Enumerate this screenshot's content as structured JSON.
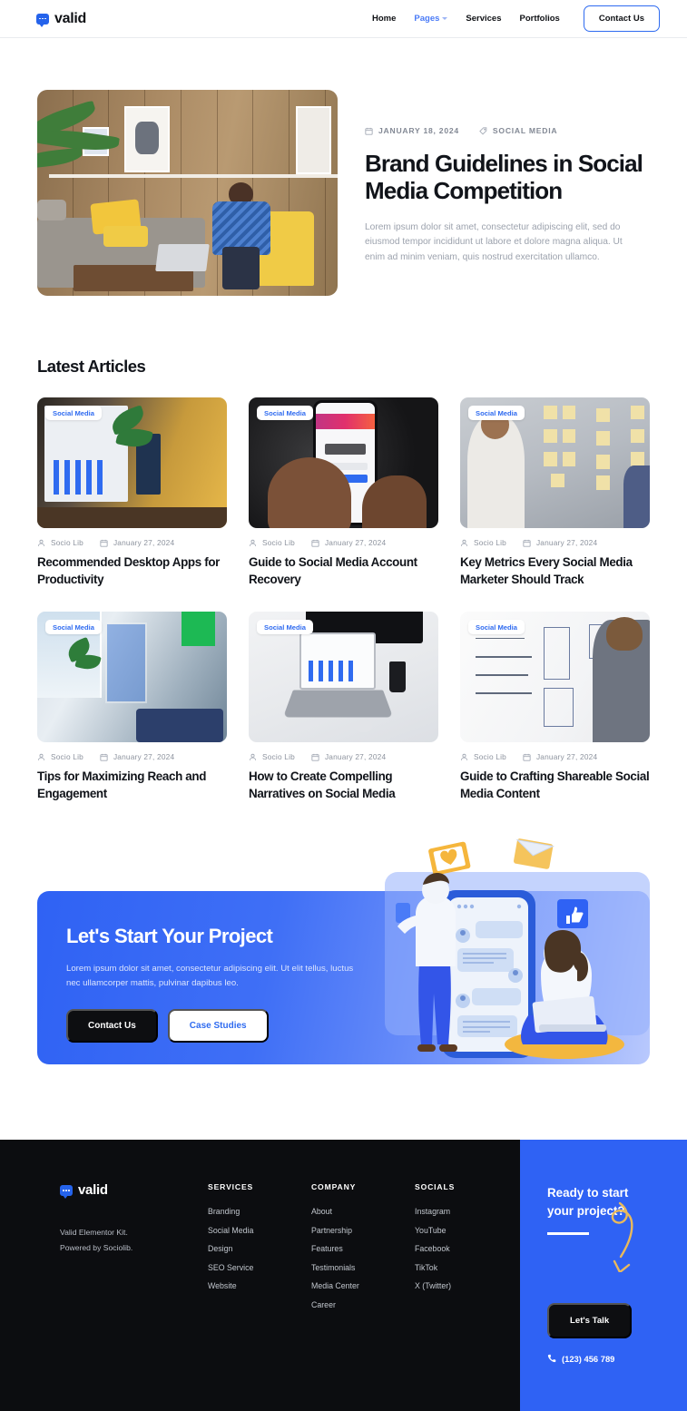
{
  "colors": {
    "brand_blue": "#2f62f4",
    "nav_active": "#4a7bf7",
    "dark": "#0c0d10",
    "badge_text": "#2f6bf0",
    "accent_yellow": "#e8b94a"
  },
  "header": {
    "logo": {
      "text": "valid",
      "icon": "chat-bubble-icon"
    },
    "nav": [
      {
        "label": "Home",
        "active": false,
        "has_caret": false
      },
      {
        "label": "Pages",
        "active": true,
        "has_caret": true
      },
      {
        "label": "Services",
        "active": false,
        "has_caret": false
      },
      {
        "label": "Portfolios",
        "active": false,
        "has_caret": false
      }
    ],
    "cta_label": "Contact Us"
  },
  "hero": {
    "date": "JANUARY 18, 2024",
    "date_icon": "calendar-icon",
    "category": "SOCIAL MEDIA",
    "category_icon": "tag-icon",
    "title": "Brand Guidelines in Social Media Competition",
    "description": "Lorem ipsum dolor sit amet, consectetur adipiscing elit, sed do eiusmod tempor incididunt ut labore et dolore magna aliqua. Ut enim ad minim veniam, quis nostrud exercitation ullamco.",
    "image_alt": "man-in-plaid-shirt-seated-in-living-room"
  },
  "latest": {
    "heading": "Latest Articles",
    "cards": [
      {
        "badge": "Social Media",
        "author": "Socio Lib",
        "date": "January 27, 2024",
        "title": "Recommended Desktop Apps for Productivity",
        "thumb": "t-desk"
      },
      {
        "badge": "Social Media",
        "author": "Socio Lib",
        "date": "January 27, 2024",
        "title": "Guide to Social Media Account Recovery",
        "thumb": "t-phone"
      },
      {
        "badge": "Social Media",
        "author": "Socio Lib",
        "date": "January 27, 2024",
        "title": "Key Metrics Every Social Media Marketer Should Track",
        "thumb": "t-board"
      },
      {
        "badge": "Social Media",
        "author": "Socio Lib",
        "date": "January 27, 2024",
        "title": "Tips for Maximizing Reach and Engagement",
        "thumb": "t-office"
      },
      {
        "badge": "Social Media",
        "author": "Socio Lib",
        "date": "January 27, 2024",
        "title": "How to Create Compelling Narratives on Social Media",
        "thumb": "t-laptop"
      },
      {
        "badge": "Social Media",
        "author": "Socio Lib",
        "date": "January 27, 2024",
        "title": "Guide to Crafting Shareable Social Media Content",
        "thumb": "t-white"
      }
    ]
  },
  "cta": {
    "heading": "Let's Start Your Project",
    "description": "Lorem ipsum dolor sit amet, consectetur adipiscing elit. Ut elit tellus, luctus nec ullamcorper mattis, pulvinar dapibus leo.",
    "primary_label": "Contact Us",
    "secondary_label": "Case Studies",
    "illustration_alt": "two-people-chatting-on-giant-phone"
  },
  "footer": {
    "brand": {
      "text": "valid",
      "icon": "chat-bubble-icon"
    },
    "note_line1": "Valid Elementor Kit.",
    "note_line2": "Powered by Sociolib.",
    "columns": [
      {
        "heading": "SERVICES",
        "links": [
          "Branding",
          "Social Media",
          "Design",
          "SEO Service",
          "Website"
        ]
      },
      {
        "heading": "COMPANY",
        "links": [
          "About",
          "Partnership",
          "Features",
          "Testimonials",
          "Media Center",
          "Career"
        ]
      },
      {
        "heading": "SOCIALS",
        "links": [
          "Instagram",
          "YouTube",
          "Facebook",
          "TikTok",
          "X (Twitter)"
        ]
      }
    ],
    "panel": {
      "heading_line1": "Ready to start",
      "heading_line2": "your project?",
      "button_label": "Let's Talk",
      "phone": "(123) 456 789",
      "phone_icon": "phone-icon",
      "arrow_icon": "curved-arrow-icon"
    }
  }
}
